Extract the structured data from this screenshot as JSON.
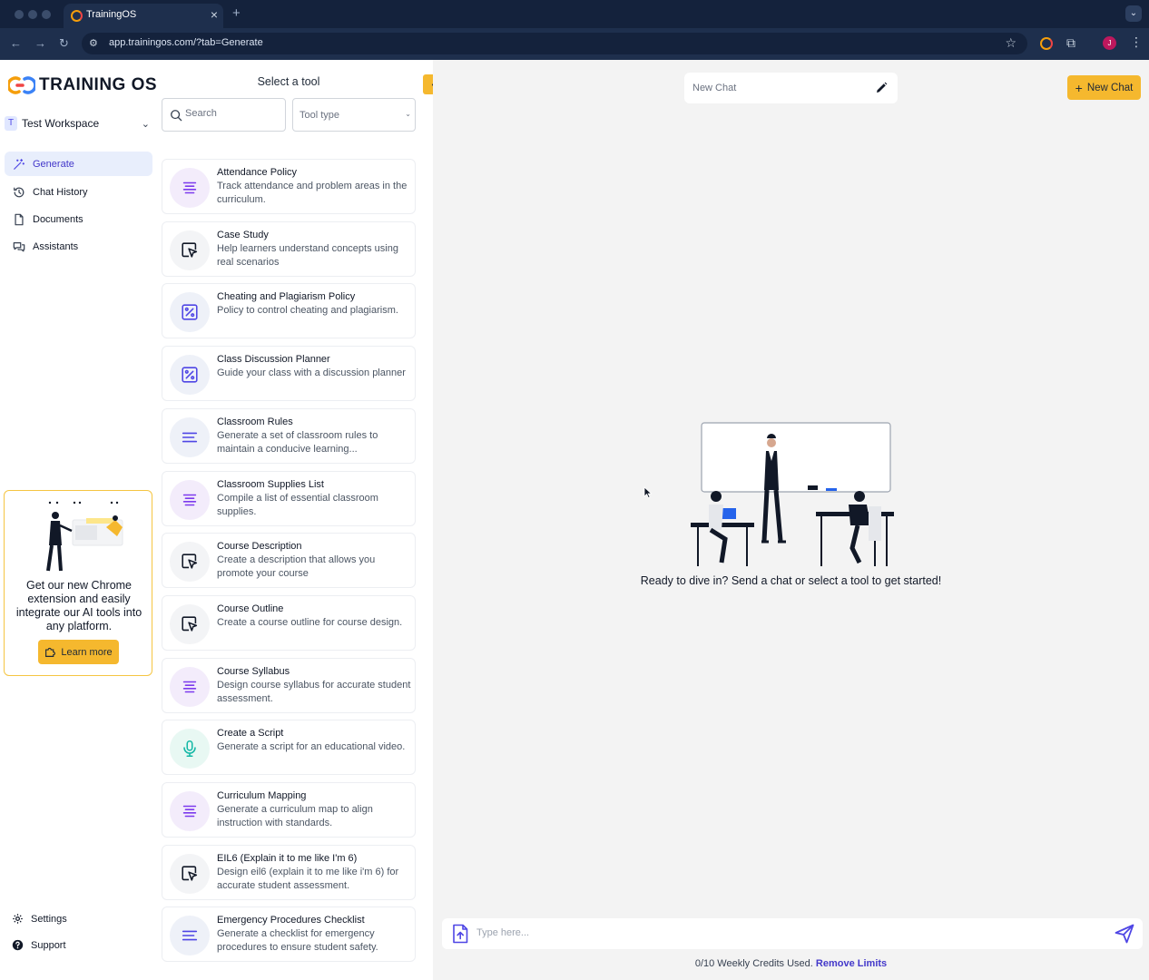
{
  "browser": {
    "tab_title": "TrainingOS",
    "url": "app.trainingos.com/?tab=Generate",
    "profile_initial": "J"
  },
  "sidebar": {
    "logo_text": "TRAINING OS",
    "workspace_initial": "T",
    "workspace_name": "Test Workspace",
    "nav": [
      {
        "label": "Generate",
        "icon": "magic-wand-icon",
        "active": true
      },
      {
        "label": "Chat History",
        "icon": "history-icon"
      },
      {
        "label": "Documents",
        "icon": "document-icon"
      },
      {
        "label": "Assistants",
        "icon": "chat-bubbles-icon"
      }
    ],
    "promo": {
      "text": "Get our new Chrome extension and easily integrate our AI tools into any platform.",
      "button_label": "Learn more"
    },
    "settings_label": "Settings",
    "support_label": "Support"
  },
  "tool_panel": {
    "title": "Select a tool",
    "search_placeholder": "Search",
    "type_placeholder": "Tool type",
    "tools": [
      {
        "name": "Attendance Policy",
        "desc": "Track attendance and problem areas in the curriculum.",
        "icon": "lines-icon",
        "tone": "purple"
      },
      {
        "name": "Case Study",
        "desc": "Help learners understand concepts using real scenarios",
        "icon": "cursor-box-icon",
        "tone": "gray"
      },
      {
        "name": "Cheating and Plagiarism Policy",
        "desc": "Policy to control cheating and plagiarism.",
        "icon": "percent-box-icon",
        "tone": "blue"
      },
      {
        "name": "Class Discussion Planner",
        "desc": "Guide your class with a discussion planner",
        "icon": "percent-box-icon",
        "tone": "blue"
      },
      {
        "name": "Classroom Rules",
        "desc": "Generate a set of classroom rules to maintain a conducive learning...",
        "icon": "text-lines-icon",
        "tone": "blue"
      },
      {
        "name": "Classroom Supplies List",
        "desc": "Compile a list of essential classroom supplies.",
        "icon": "lines-icon",
        "tone": "purple"
      },
      {
        "name": "Course Description",
        "desc": "Create a description that allows you promote your course",
        "icon": "cursor-box-icon",
        "tone": "gray"
      },
      {
        "name": "Course Outline",
        "desc": "Create a course outline for course design.",
        "icon": "cursor-box-icon",
        "tone": "gray"
      },
      {
        "name": "Course Syllabus",
        "desc": "Design course syllabus for accurate student assessment.",
        "icon": "lines-icon",
        "tone": "purple"
      },
      {
        "name": "Create a Script",
        "desc": "Generate a script for an educational video.",
        "icon": "microphone-icon",
        "tone": "green"
      },
      {
        "name": "Curriculum Mapping",
        "desc": "Generate a curriculum map to align instruction with standards.",
        "icon": "lines-icon",
        "tone": "purple"
      },
      {
        "name": "EIL6 (Explain it to me like I'm 6)",
        "desc": "Design eil6 (explain it to me like i'm 6) for accurate student assessment.",
        "icon": "cursor-box-icon",
        "tone": "gray"
      },
      {
        "name": "Emergency Procedures Checklist",
        "desc": "Generate a checklist for emergency procedures to ensure student safety.",
        "icon": "text-lines-icon",
        "tone": "blue"
      }
    ]
  },
  "main": {
    "chat_title_placeholder": "New Chat",
    "new_chat_label": "New Chat",
    "ready_text": "Ready to dive in? Send a chat or select a tool to get started!",
    "composer_placeholder": "Type here...",
    "credits_text": "0/10 Weekly Credits Used.",
    "remove_limits_label": "Remove Limits"
  },
  "colors": {
    "accent": "#f5b82e",
    "brand_indigo": "#4f46e5",
    "chrome": "#1e2f4d",
    "main_bg": "#f3f3f3"
  }
}
